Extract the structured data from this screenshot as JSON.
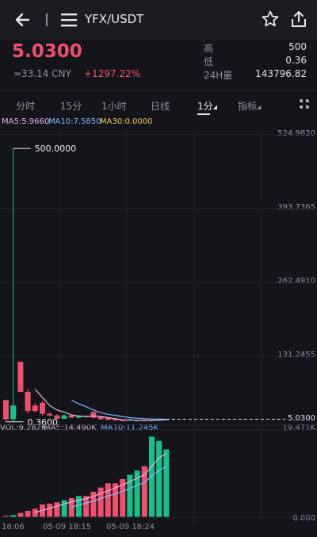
{
  "header": {
    "pair": "YFX/USDT",
    "back_icon": "arrow-left-icon",
    "menu_icon": "hamburger-icon",
    "star_icon": "star-icon",
    "share_icon": "share-icon"
  },
  "ticker": {
    "price": "5.0300",
    "cny": "≈33.14 CNY",
    "change": "+1297.22%",
    "high_label": "高",
    "high": "500",
    "low_label": "低",
    "low": "0.36",
    "vol_label": "24H量",
    "vol": "143796.82"
  },
  "tabs": [
    {
      "label": "分时"
    },
    {
      "label": "15分"
    },
    {
      "label": "1小时"
    },
    {
      "label": "日线"
    },
    {
      "label": "1分"
    },
    {
      "label": "指标"
    }
  ],
  "indicators": {
    "ma5": "MA5:5.9660",
    "ma10": "MA10:7.5850",
    "ma30": "MA30:0.0000"
  },
  "colors": {
    "up": "#17c08a",
    "down": "#f0506e",
    "ma5": "#e6b3e6",
    "ma10": "#7db8ff",
    "ma30": "#f3c35b"
  },
  "chart_data": {
    "type": "candlestick",
    "price_axis": [
      "524.9820",
      "393.7365",
      "262.4910",
      "131.2455",
      "5.0300"
    ],
    "ylim": [
      0,
      524.982
    ],
    "max_label": "500.0000",
    "min_label": "0.3600",
    "candles": [
      {
        "o": 40,
        "c": 5,
        "h": 40,
        "l": 0.36
      },
      {
        "o": 5,
        "c": 30,
        "h": 500,
        "l": 0.36
      },
      {
        "o": 110,
        "c": 55,
        "h": 110,
        "l": 55
      },
      {
        "o": 55,
        "c": 20,
        "h": 60,
        "l": 15
      },
      {
        "o": 30,
        "c": 20,
        "h": 35,
        "l": 18
      },
      {
        "o": 35,
        "c": 15,
        "h": 38,
        "l": 12
      },
      {
        "o": 15,
        "c": 12,
        "h": 18,
        "l": 10
      },
      {
        "o": 12,
        "c": 6,
        "h": 14,
        "l": 5
      },
      {
        "o": 6,
        "c": 12,
        "h": 14,
        "l": 5
      },
      {
        "o": 12,
        "c": 8,
        "h": 13,
        "l": 7
      },
      {
        "o": 8,
        "c": 11,
        "h": 12,
        "l": 7
      },
      {
        "o": 11,
        "c": 9,
        "h": 12,
        "l": 8
      },
      {
        "o": 18,
        "c": 8,
        "h": 20,
        "l": 6
      },
      {
        "o": 10,
        "c": 5,
        "h": 11,
        "l": 4
      },
      {
        "o": 8,
        "c": 4,
        "h": 9,
        "l": 3
      },
      {
        "o": 5,
        "c": 3,
        "h": 6,
        "l": 2
      },
      {
        "o": 3,
        "c": 2,
        "h": 4,
        "l": 1
      },
      {
        "o": 3,
        "c": 5,
        "h": 6,
        "l": 2
      },
      {
        "o": 2,
        "c": 3,
        "h": 4,
        "l": 1
      },
      {
        "o": 3,
        "c": 2,
        "h": 4,
        "l": 1
      },
      {
        "o": 2,
        "c": 3,
        "h": 4,
        "l": 1
      },
      {
        "o": 3,
        "c": 4,
        "h": 5,
        "l": 2
      },
      {
        "o": 4,
        "c": 5,
        "h": 6,
        "l": 3
      }
    ],
    "ma5_series": [
      null,
      null,
      null,
      null,
      60,
      45,
      30,
      22,
      18,
      13,
      11,
      10,
      11,
      10,
      8,
      6,
      4,
      3.5,
      3,
      3,
      3,
      3.5,
      4
    ],
    "ma10_series": [
      null,
      null,
      null,
      null,
      null,
      null,
      null,
      null,
      null,
      40,
      33,
      28,
      22,
      17,
      14,
      12,
      10,
      8,
      7,
      6,
      5.5,
      5.2,
      5
    ],
    "volume": {
      "label": "VOL:9.282K",
      "ma5_label": "MA5:14.490K",
      "ma10_label": "MA10:11.245K",
      "axis_top": "19.471K",
      "axis_bottom": "0.000",
      "values": [
        0.3,
        0.5,
        1,
        1.5,
        2,
        3,
        3.2,
        3.5,
        4,
        4.5,
        5,
        5,
        6,
        7,
        8,
        8,
        9,
        10,
        11,
        12,
        19,
        18,
        16
      ],
      "ma5": [
        null,
        null,
        null,
        null,
        1.1,
        1.6,
        2.1,
        2.6,
        3.1,
        3.6,
        4.0,
        4.4,
        4.9,
        5.6,
        6.2,
        6.9,
        7.6,
        8.4,
        9.2,
        10,
        12,
        14,
        15
      ],
      "ma10": [
        null,
        null,
        null,
        null,
        null,
        null,
        null,
        null,
        null,
        2.4,
        2.9,
        3.3,
        3.8,
        4.4,
        5,
        5.5,
        6.1,
        6.8,
        7.5,
        8.2,
        9.7,
        11,
        12
      ]
    },
    "time_labels": [
      "18:06",
      "05-09 18:15",
      "05-09 18:24"
    ]
  }
}
